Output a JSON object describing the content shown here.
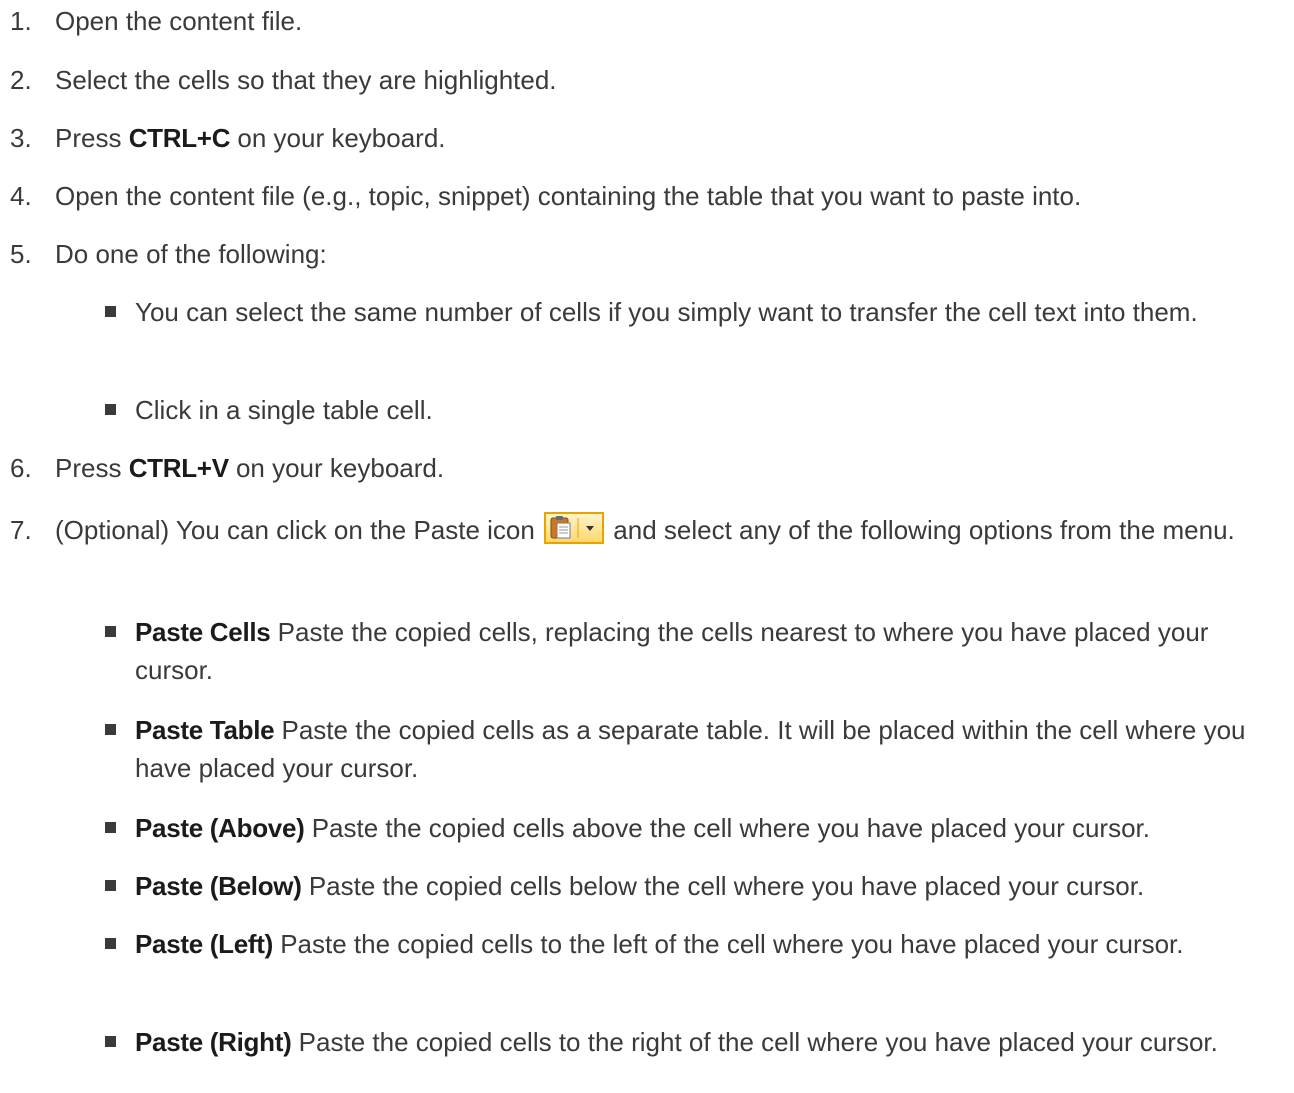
{
  "steps": [
    {
      "num": "1.",
      "text": "Open the content file."
    },
    {
      "num": "2.",
      "text": "Select the cells so that they are highlighted."
    },
    {
      "num": "3.",
      "before": "Press ",
      "key": "CTRL+C",
      "after": " on your keyboard."
    },
    {
      "num": "4.",
      "text": "Open the content file (e.g., topic, snippet) containing the table that you want to paste into."
    },
    {
      "num": "5.",
      "text": "Do one of the following:",
      "subs": [
        {
          "text": "You can select the same number of cells if you simply want to transfer the cell text into them."
        },
        {
          "text": "Click in a single table cell."
        }
      ]
    },
    {
      "num": "6.",
      "before": "Press ",
      "key": "CTRL+V",
      "after": " on your keyboard."
    },
    {
      "num": "7.",
      "before": "(Optional) You can click on the Paste icon ",
      "after": " and select any of the following options from the menu.",
      "icon": "paste-icon",
      "subs": [
        {
          "term": "Paste Cells",
          "text": " Paste the copied cells, replacing the cells nearest to where you have placed your cursor."
        },
        {
          "term": "Paste Table",
          "text": " Paste the copied cells as a separate table. It will be placed within the cell where you have placed your cursor."
        },
        {
          "term": "Paste (Above)",
          "text": " Paste the copied cells above the cell where you have placed your cursor."
        },
        {
          "term": "Paste (Below)",
          "text": " Paste the copied cells below the cell where you have placed your cursor."
        },
        {
          "term": "Paste (Left)",
          "text": " Paste the copied cells to the left of the cell where you have placed your cursor."
        },
        {
          "term": "Paste (Right)",
          "text": " Paste the copied cells to the right of the cell where you have placed your cursor."
        }
      ]
    }
  ],
  "colors": {
    "text": "#3a3a3a",
    "emphasis": "#1b1b1b",
    "icon_border": "#e8a300"
  }
}
